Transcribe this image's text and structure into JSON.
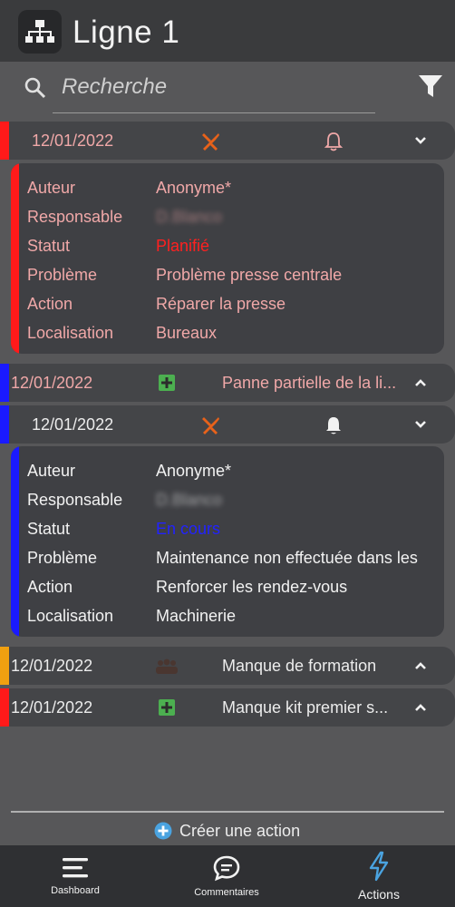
{
  "header": {
    "title": "Ligne 1"
  },
  "search": {
    "placeholder": "Recherche"
  },
  "items": [
    {
      "date": "12/01/2022",
      "bar_color": "#ff1a1a",
      "card": {
        "bar_color": "#ff1a1a",
        "rows": [
          {
            "label": "Auteur",
            "value": "Anonyme*"
          },
          {
            "label": "Responsable",
            "value": "D.Blanco"
          },
          {
            "label": "Statut",
            "value": "Planifié"
          },
          {
            "label": "Problème",
            "value": "Problème presse centrale"
          },
          {
            "label": "Action",
            "value": "Réparer la presse"
          },
          {
            "label": "Localisation",
            "value": "Bureaux"
          }
        ]
      }
    },
    {
      "date": "12/01/2022",
      "title": "Panne partielle de la li...",
      "bar_color": "#1a1aff"
    },
    {
      "date": "12/01/2022",
      "bar_color": "#1a1aff",
      "card": {
        "bar_color": "#1a1aff",
        "rows": [
          {
            "label": "Auteur",
            "value": "Anonyme*"
          },
          {
            "label": "Responsable",
            "value": "D.Blanco"
          },
          {
            "label": "Statut",
            "value": "En cours"
          },
          {
            "label": "Problème",
            "value": "Maintenance non effectuée dans les"
          },
          {
            "label": "Action",
            "value": "Renforcer les rendez-vous"
          },
          {
            "label": "Localisation",
            "value": "Machinerie"
          }
        ]
      }
    },
    {
      "date": "12/01/2022",
      "title": "Manque de formation",
      "bar_color": "#f0a010"
    },
    {
      "date": "12/01/2022",
      "title": "Manque kit premier s...",
      "bar_color": "#ff1a1a"
    }
  ],
  "create_action": "Créer une action",
  "nav": {
    "dashboard": "Dashboard",
    "comments": "Commentaires",
    "actions": "Actions"
  },
  "colors": {
    "accent_blue": "#4aa3e0",
    "orange_icon": "#e8621a",
    "green_icon": "#4caf50"
  }
}
